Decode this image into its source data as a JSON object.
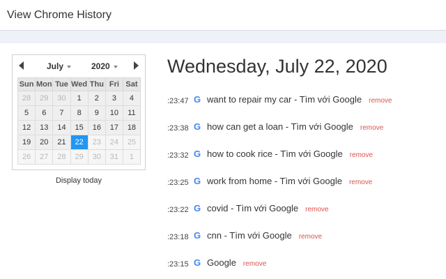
{
  "app": {
    "title": "View Chrome History"
  },
  "calendar": {
    "month": "July",
    "year": "2020",
    "weekdays": [
      "Sun",
      "Mon",
      "Tue",
      "Wed",
      "Thu",
      "Fri",
      "Sat"
    ],
    "weeks": [
      [
        "28",
        "29",
        "30",
        "1",
        "2",
        "3",
        "4"
      ],
      [
        "5",
        "6",
        "7",
        "8",
        "9",
        "10",
        "11"
      ],
      [
        "12",
        "13",
        "14",
        "15",
        "16",
        "17",
        "18"
      ],
      [
        "19",
        "20",
        "21",
        "22",
        "23",
        "24",
        "25"
      ],
      [
        "26",
        "27",
        "28",
        "29",
        "30",
        "31",
        "1"
      ]
    ],
    "selected_day": "22",
    "display_today_label": "Display today"
  },
  "main": {
    "date_heading": "Wednesday, July 22, 2020",
    "entries": [
      {
        "time": ":23:47",
        "icon": "google-icon",
        "title": "want to repair my car - Tìm với Google",
        "remove": "remove"
      },
      {
        "time": ":23:38",
        "icon": "google-icon",
        "title": "how can get a loan - Tìm với Google",
        "remove": "remove"
      },
      {
        "time": ":23:32",
        "icon": "google-icon",
        "title": "how to cook rice - Tìm với Google",
        "remove": "remove"
      },
      {
        "time": ":23:25",
        "icon": "google-icon",
        "title": "work from home - Tìm với Google",
        "remove": "remove"
      },
      {
        "time": ":23:22",
        "icon": "google-icon",
        "title": "covid - Tìm với Google",
        "remove": "remove"
      },
      {
        "time": ":23:18",
        "icon": "google-icon",
        "title": "cnn - Tìm với Google",
        "remove": "remove"
      },
      {
        "time": ":23:15",
        "icon": "google-icon",
        "title": "Google",
        "remove": "remove"
      }
    ]
  },
  "colors": {
    "accent": "#2196f3",
    "remove": "#d9534f",
    "google_blue": "#4285f4"
  }
}
